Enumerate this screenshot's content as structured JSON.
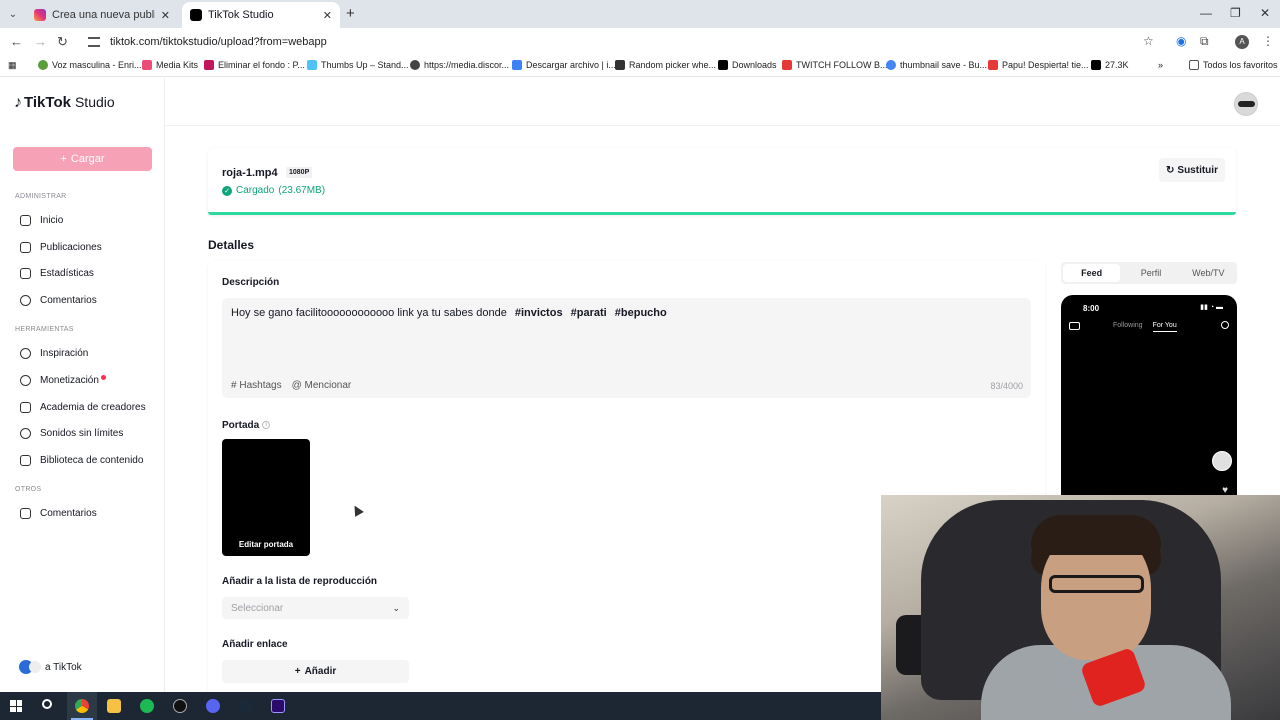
{
  "browser": {
    "tabs": [
      {
        "title": "Crea una nueva publicación • In",
        "active": false
      },
      {
        "title": "TikTok Studio",
        "active": true
      }
    ],
    "url": "tiktok.com/tiktokstudio/upload?from=webapp",
    "profile_initial": "A",
    "bookmarks": [
      "Voz masculina - Enri...",
      "Media Kits",
      "Eliminar el fondo : P...",
      "Thumbs Up – Stand...",
      "https://media.discor...",
      "Descargar archivo | i...",
      "Random picker whe...",
      "Downloads",
      "TWITCH FOLLOW B...",
      "thumbnail save - Bu...",
      "Papu! Despierta! tie...",
      "27.3K"
    ],
    "all_favorites": "Todos los favoritos"
  },
  "sidebar": {
    "logo": {
      "brand": "TikTok",
      "product": "Studio"
    },
    "upload_label": "Cargar",
    "sections": [
      {
        "title": "ADMINISTRAR",
        "items": [
          "Inicio",
          "Publicaciones",
          "Estadísticas",
          "Comentarios"
        ]
      },
      {
        "title": "HERRAMIENTAS",
        "items": [
          "Inspiración",
          "Monetización",
          "Academia de creadores",
          "Sonidos sin límites",
          "Biblioteca de contenido"
        ]
      },
      {
        "title": "OTROS",
        "items": [
          "Comentarios"
        ]
      }
    ],
    "footer": "a TikTok"
  },
  "upload": {
    "file_name": "roja-1.mp4",
    "resolution": "1080P",
    "status": "Cargado",
    "size": "(23.67MB)",
    "replace_label": "Sustituir",
    "progress": 1.0
  },
  "details": {
    "title": "Detalles",
    "description_label": "Descripción",
    "description_text": "Hoy se gano facilitoooooooooooo link ya tu sabes donde",
    "hashtags": [
      "#invictos",
      "#parati",
      "#bepucho"
    ],
    "hashtags_btn": "Hashtags",
    "mention_btn": "Mencionar",
    "char_count": "83/4000",
    "cover_label": "Portada",
    "edit_cover": "Editar portada",
    "playlist_label": "Añadir a la lista de reproducción",
    "playlist_placeholder": "Seleccionar",
    "link_label": "Añadir enlace",
    "add_label": "Añadir"
  },
  "preview": {
    "tabs": [
      "Feed",
      "Perfil",
      "Web/TV"
    ],
    "active_tab": "Feed",
    "time": "8:00",
    "following": "Following",
    "for_you": "For You"
  },
  "colors": {
    "accent": "#fe2c55",
    "upload_btn": "#f7a1b6",
    "success": "#0fa47a",
    "progress": "#2ed9a0"
  }
}
